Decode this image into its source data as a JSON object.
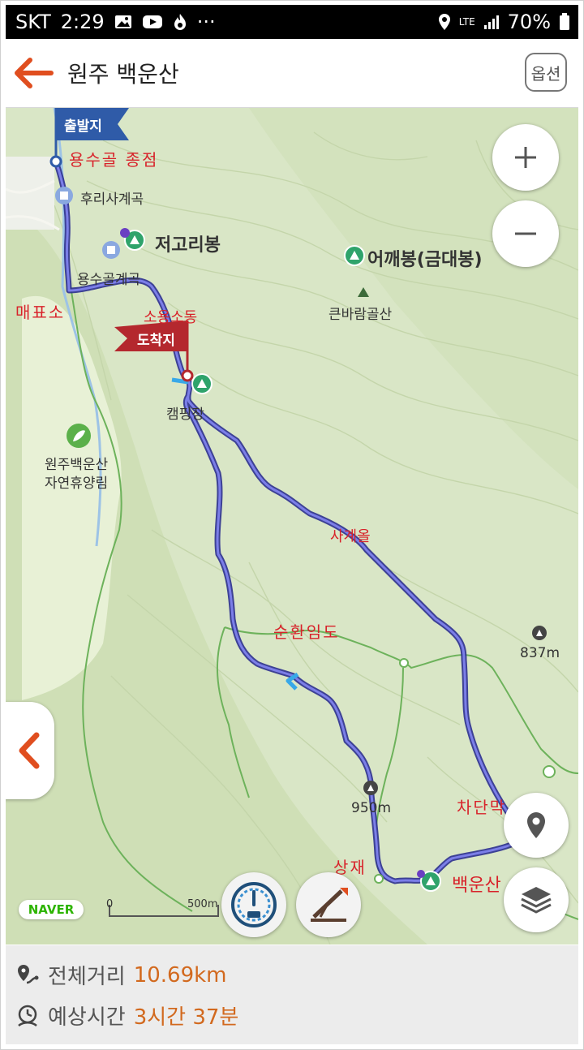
{
  "status_bar": {
    "carrier": "SKT",
    "time": "2:29",
    "more": "···",
    "network": "LTE",
    "battery": "70%"
  },
  "header": {
    "title": "원주 백운산",
    "options_label": "옵션"
  },
  "map": {
    "start_flag": "출발지",
    "end_flag": "도착지",
    "labels": {
      "yongsugol_terminus": "용수골  종점",
      "hurisa_valley": "후리사계곡",
      "jeogori_peak": "저고리봉",
      "yongsugol_valley": "용수골계곡",
      "maepyoso": "매표소",
      "soyongsodong": "소용소동",
      "eokkae_peak": "어깨봉(금대봉)",
      "keunbaram_valley": "큰바람골산",
      "camping": "캠핑장",
      "forest_line1": "원주백운산",
      "forest_line2": "자연휴양림",
      "sagyeol": "사계올",
      "loop_forest_road": "순환임도",
      "elev_837": "837m",
      "elev_950": "950m",
      "barrier": "차단막",
      "sangjae": "상재",
      "baegunsan": "백운산",
      "scale_zero": "0",
      "scale_500": "500m",
      "naver": "NAVER"
    }
  },
  "summary": {
    "distance_label": "전체거리",
    "distance_value": "10.69km",
    "time_label": "예상시간",
    "time_value": "3시간 37분"
  },
  "colors": {
    "route": "#5b5ec9",
    "accent_red": "#d8222a",
    "info_value": "#d2691e",
    "start_flag": "#2f5ba8",
    "end_flag": "#b4282e",
    "naver_green": "#2db400"
  },
  "icons": [
    "back-arrow-icon",
    "zoom-in-icon",
    "zoom-out-icon",
    "location-pin-icon",
    "layers-icon",
    "collapse-panel-icon",
    "speedometer-icon",
    "elevation-icon",
    "distance-icon",
    "clock-icon"
  ]
}
